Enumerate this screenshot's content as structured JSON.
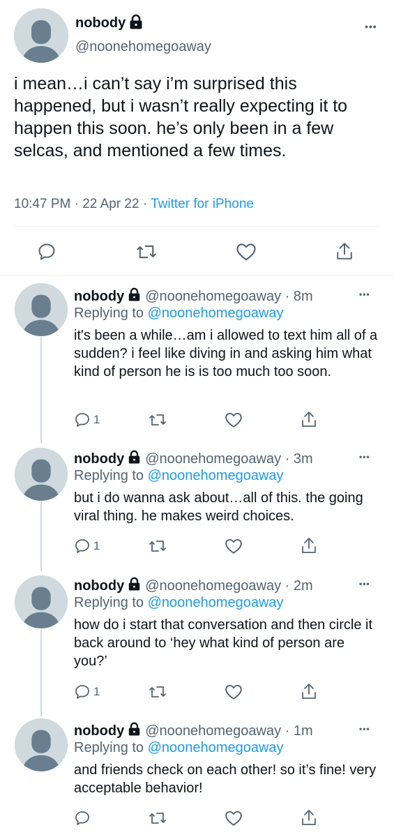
{
  "main_tweet": {
    "name": "nobody",
    "handle": "@noonehomegoaway",
    "text": "i mean…i can’t say i’m surprised this happened, but i wasn’t really expecting it to happen this soon. he’s only been in a few selcas, and mentioned a few times.",
    "time": "10:47 PM",
    "date": "22 Apr 22",
    "source": "Twitter for iPhone",
    "separator": "·"
  },
  "replies": [
    {
      "name": "nobody",
      "handle": "@noonehomegoaway · 8m",
      "replying_label": "Replying to",
      "replying_to": "@noonehomegoaway",
      "text": "it's been a while…am i allowed to text him all of a sudden? i feel like diving in and asking him what kind of person he is is too much too soon.",
      "reply_count": "1"
    },
    {
      "name": "nobody",
      "handle": "@noonehomegoaway · 3m",
      "replying_label": "Replying to",
      "replying_to": "@noonehomegoaway",
      "text": "but i do wanna ask about…all of this. the going viral thing. he makes weird choices.",
      "reply_count": "1"
    },
    {
      "name": "nobody",
      "handle": "@noonehomegoaway · 2m",
      "replying_label": "Replying to",
      "replying_to": "@noonehomegoaway",
      "text": "how do i start that conversation and then circle it back around to ‘hey what kind of person are you?’",
      "reply_count": "1"
    },
    {
      "name": "nobody",
      "handle": "@noonehomegoaway · 1m",
      "replying_label": "Replying to",
      "replying_to": "@noonehomegoaway",
      "text": "and friends check on each other! so it’s fine! very acceptable behavior!",
      "reply_count": ""
    }
  ],
  "more_label": "•••",
  "icons": {
    "reply": "reply-icon",
    "retweet": "retweet-icon",
    "like": "like-icon",
    "share": "share-icon",
    "lock": "lock-icon",
    "avatar": "default-avatar-icon"
  },
  "colors": {
    "link": "#1d9bf0",
    "secondary_text": "#536471",
    "primary_text": "#0f1419",
    "avatar_bg": "#cfd9de",
    "avatar_fg": "#697f8f"
  }
}
